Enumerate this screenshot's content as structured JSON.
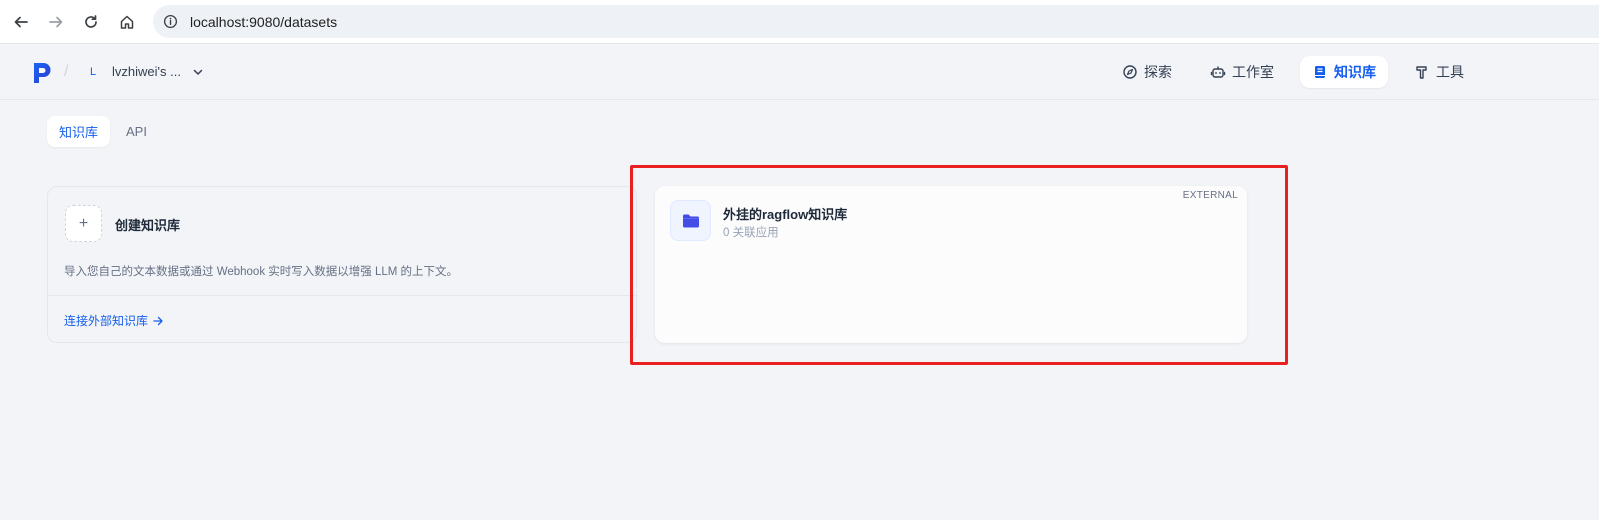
{
  "browser": {
    "url": "localhost:9080/datasets"
  },
  "header": {
    "workspace_initial": "L",
    "workspace_name": "lvzhiwei's ...",
    "nav": [
      {
        "label": "探索",
        "icon": "compass-icon"
      },
      {
        "label": "工作室",
        "icon": "robot-icon"
      },
      {
        "label": "知识库",
        "icon": "book-icon",
        "active": true
      },
      {
        "label": "工具",
        "icon": "hammer-icon"
      }
    ]
  },
  "tabs": [
    {
      "label": "知识库",
      "active": true
    },
    {
      "label": "API"
    }
  ],
  "create_card": {
    "plus": "+",
    "title": "创建知识库",
    "description": "导入您自己的文本数据或通过 Webhook 实时写入数据以增强 LLM 的上下文。",
    "connect_link": "连接外部知识库"
  },
  "dataset_card": {
    "title": "外挂的ragflow知识库",
    "subtitle": "0 关联应用",
    "badge": "EXTERNAL",
    "icon": "folder-icon"
  },
  "colors": {
    "accent": "#155eef",
    "highlight": "#ea1f1f",
    "folder": "#444ce7"
  }
}
